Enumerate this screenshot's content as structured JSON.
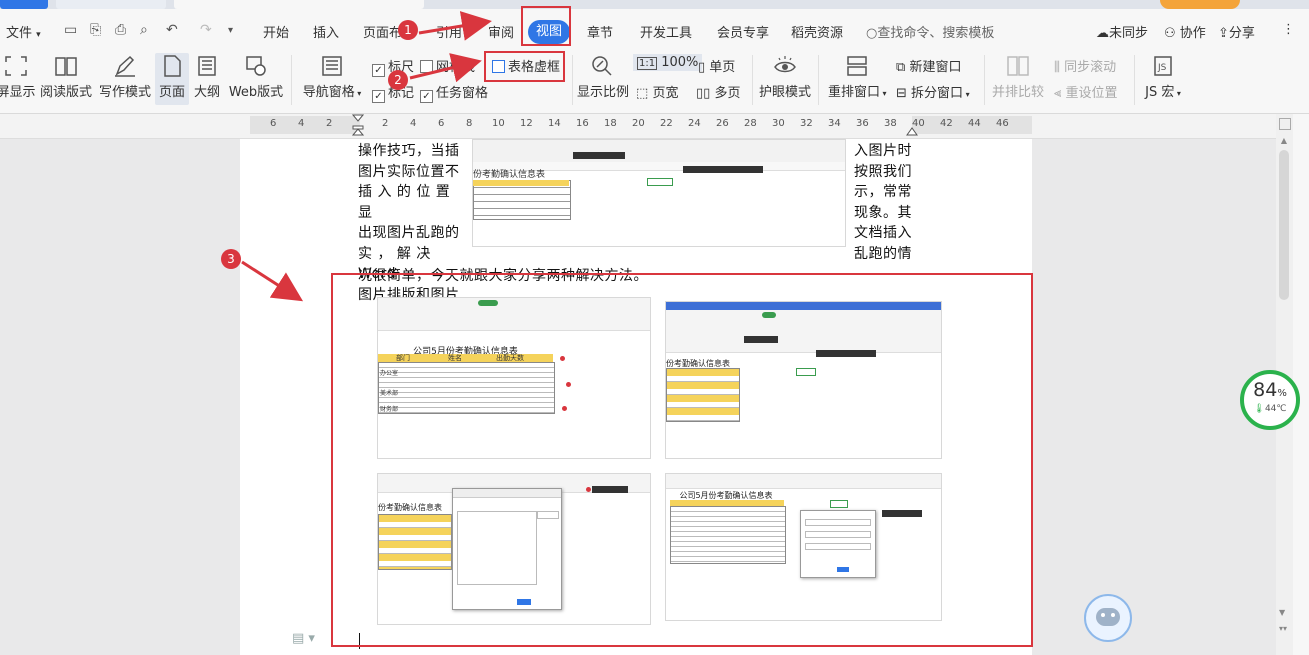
{
  "menu": {
    "file": "文件",
    "tabs": [
      "开始",
      "插入",
      "页面布",
      "引用",
      "审阅",
      "视图",
      "章节",
      "开发工具",
      "会员专享",
      "稻壳资源"
    ],
    "active_tab": "视图",
    "search": "查找命令、搜索模板",
    "sync": "未同步",
    "collab": "协作",
    "share": "分享"
  },
  "ribbon": {
    "fullscreen": "屏显示",
    "read_mode": "阅读版式",
    "write_mode": "写作模式",
    "page": "页面",
    "outline": "大纲",
    "web": "Web版式",
    "nav_pane": "导航窗格",
    "ruler": "标尺",
    "gridlines": "网格线",
    "marks": "标记",
    "task_pane": "任务窗格",
    "table_gridlines": "表格虚框",
    "zoom": "显示比例",
    "zoom_value": "100%",
    "zoom_1to1": "1:1",
    "single_page": "单页",
    "page_width": "页宽",
    "multi_page": "多页",
    "eye_protect": "护眼模式",
    "rearrange": "重排窗口",
    "new_window": "新建窗口",
    "split_window": "拆分窗口",
    "side_by_side": "并排比较",
    "sync_scroll": "同步滚动",
    "reset_pos": "重设位置",
    "js_macro": "JS 宏"
  },
  "ruler_ticks": [
    "6",
    "4",
    "2",
    "2",
    "4",
    "6",
    "8",
    "10",
    "12",
    "14",
    "16",
    "18",
    "20",
    "22",
    "24",
    "26",
    "28",
    "30",
    "32",
    "34",
    "36",
    "38",
    "40",
    "42",
    "44",
    "46"
  ],
  "document": {
    "left_col": [
      "操作技巧，当插",
      "图片实际位置不",
      "插 入 的 位 置 显",
      "出现图片乱跑的",
      "实 ， 解 决  Word",
      "图片排版和图片"
    ],
    "right_col": [
      "入图片时",
      "按照我们",
      "示，常常",
      "现象。其",
      "文档插入",
      "乱跑的情"
    ],
    "last_line": "况很简单，今天就跟大家分享两种解决方法。"
  },
  "annotations": [
    "1",
    "2",
    "3"
  ],
  "embedded": {
    "sheet_title_a": "公司5月份考勤确认信息表",
    "sheet_title_b": "份考勤确认信息表",
    "col_dept": "部门",
    "col_name": "姓名",
    "col_days": "出勤天数",
    "dept_finance": "财务部",
    "dept_art": "美术部",
    "dept_office": "办公室"
  },
  "badge": {
    "percent": "84",
    "unit": "%",
    "temp": "44℃"
  },
  "colors": {
    "accent": "#2f76e6",
    "annotation_red": "#d9363e",
    "badge_green": "#2bb24c"
  }
}
